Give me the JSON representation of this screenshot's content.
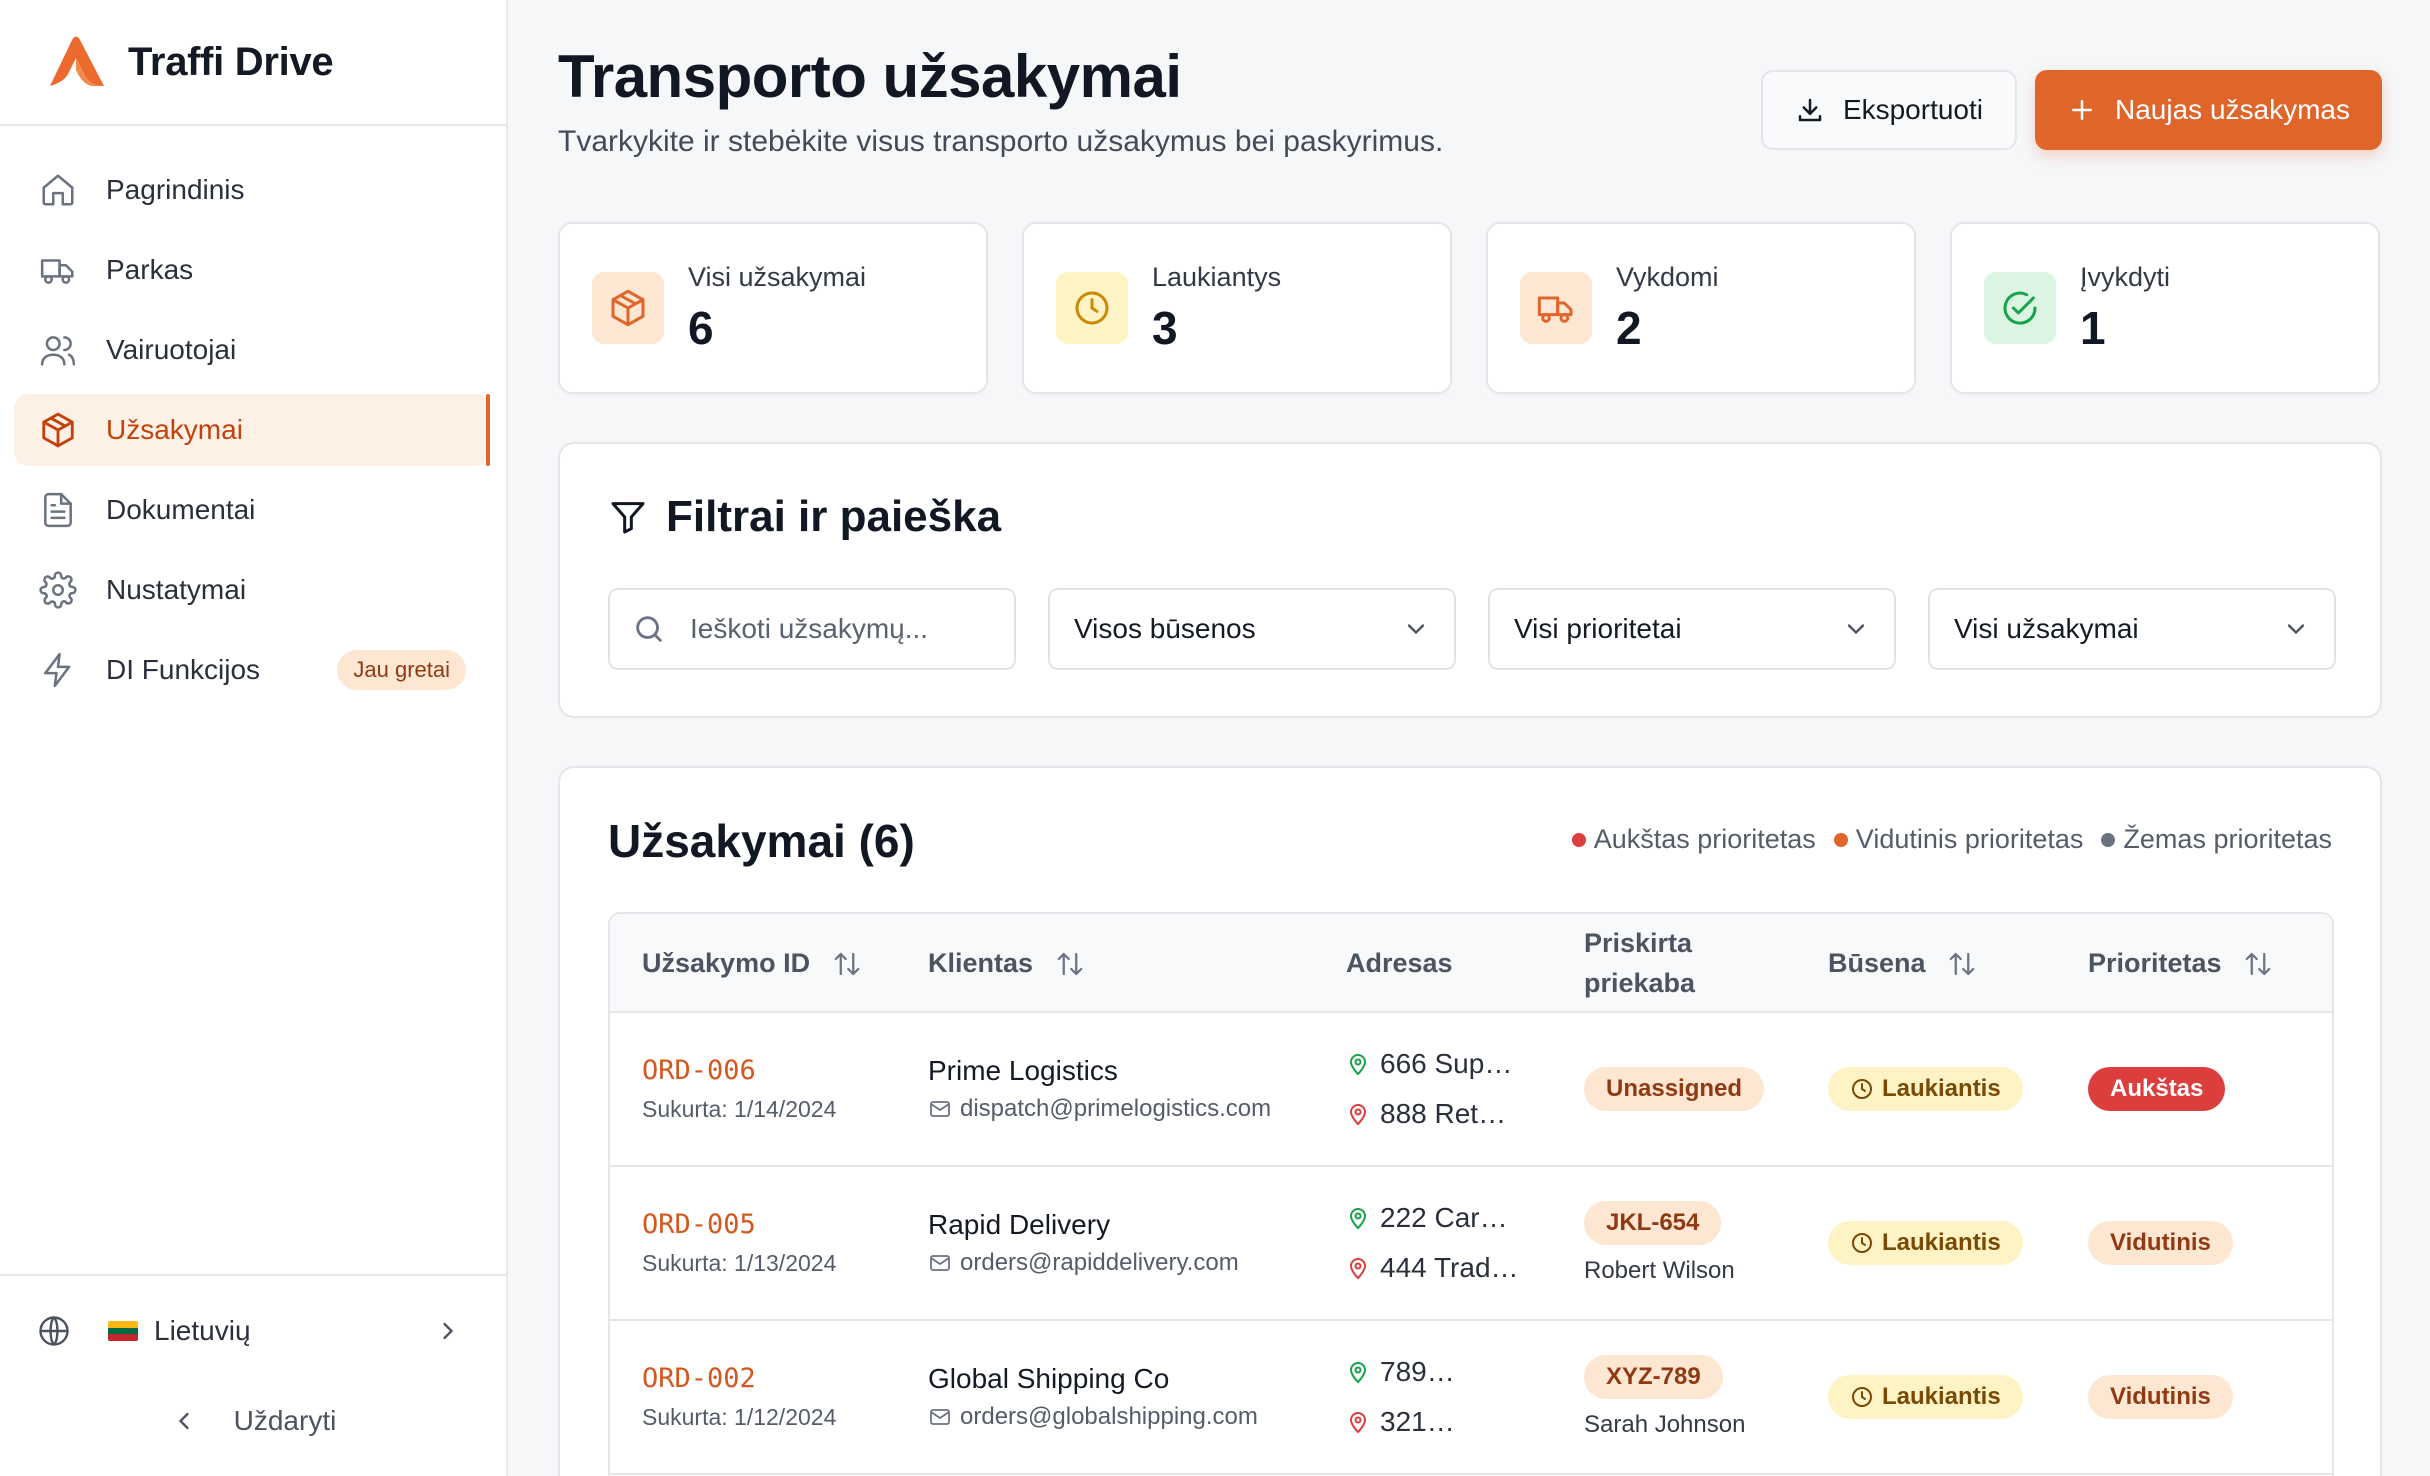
{
  "brand": {
    "name": "Traffi Drive"
  },
  "sidebar": {
    "items": [
      {
        "label": "Pagrindinis",
        "icon": "home-icon"
      },
      {
        "label": "Parkas",
        "icon": "truck-icon"
      },
      {
        "label": "Vairuotojai",
        "icon": "users-icon"
      },
      {
        "label": "Užsakymai",
        "icon": "package-icon",
        "active": true
      },
      {
        "label": "Dokumentai",
        "icon": "document-icon"
      },
      {
        "label": "Nustatymai",
        "icon": "gear-icon"
      },
      {
        "label": "DI Funkcijos",
        "icon": "lightning-icon",
        "badge": "Jau gretai"
      }
    ],
    "language": "Lietuvių",
    "collapse_label": "Uždaryti"
  },
  "header": {
    "title": "Transporto užsakymai",
    "subtitle": "Tvarkykite ir stebėkite visus transporto užsakymus bei paskyrimus.",
    "export_label": "Eksportuoti",
    "new_order_label": "Naujas užsakymas"
  },
  "stats": [
    {
      "label": "Visi užsakymai",
      "value": "6",
      "icon": "package-icon",
      "color": "#e0652a"
    },
    {
      "label": "Laukiantys",
      "value": "3",
      "icon": "clock-icon",
      "color": "#ca8a04"
    },
    {
      "label": "Vykdomi",
      "value": "2",
      "icon": "truck-icon",
      "color": "#e0652a"
    },
    {
      "label": "Įvykdyti",
      "value": "1",
      "icon": "check-circle-icon",
      "color": "#16a34a"
    }
  ],
  "filters": {
    "title": "Filtrai ir paieška",
    "search_placeholder": "Ieškoti užsakymų...",
    "status_select": "Visos būsenos",
    "priority_select": "Visi prioritetai",
    "orders_select": "Visi užsakymai"
  },
  "orders": {
    "title": "Užsakymai (6)",
    "legend": [
      {
        "label": "Aukštas prioritetas",
        "color": "#dc3d3d"
      },
      {
        "label": "Vidutinis prioritetas",
        "color": "#e0652a"
      },
      {
        "label": "Žemas prioritetas",
        "color": "#6b7280"
      }
    ],
    "columns": {
      "id": "Užsakymo ID",
      "client": "Klientas",
      "address": "Adresas",
      "trailer": "Priskirta priekaba",
      "status": "Būsena",
      "priority": "Prioritetas"
    },
    "rows": [
      {
        "id": "ORD-006",
        "created": "Sukurta: 1/14/2024",
        "client": "Prime Logistics",
        "email": "dispatch@primelogistics.com",
        "pickup": "666 Sup…",
        "dropoff": "888 Reta…",
        "trailer": "Unassigned",
        "driver": "",
        "status": "Laukiantis",
        "priority": "Aukštas"
      },
      {
        "id": "ORD-005",
        "created": "Sukurta: 1/13/2024",
        "client": "Rapid Delivery",
        "email": "orders@rapiddelivery.com",
        "pickup": "222 Car…",
        "dropoff": "444 Trad…",
        "trailer": "JKL-654",
        "driver": "Robert Wilson",
        "status": "Laukiantis",
        "priority": "Vidutinis"
      },
      {
        "id": "ORD-002",
        "created": "Sukurta: 1/12/2024",
        "client": "Global Shipping Co",
        "email": "orders@globalshipping.com",
        "pickup": "789…",
        "dropoff": "321…",
        "trailer": "XYZ-789",
        "driver": "Sarah Johnson",
        "status": "Laukiantis",
        "priority": "Vidutinis"
      }
    ]
  }
}
